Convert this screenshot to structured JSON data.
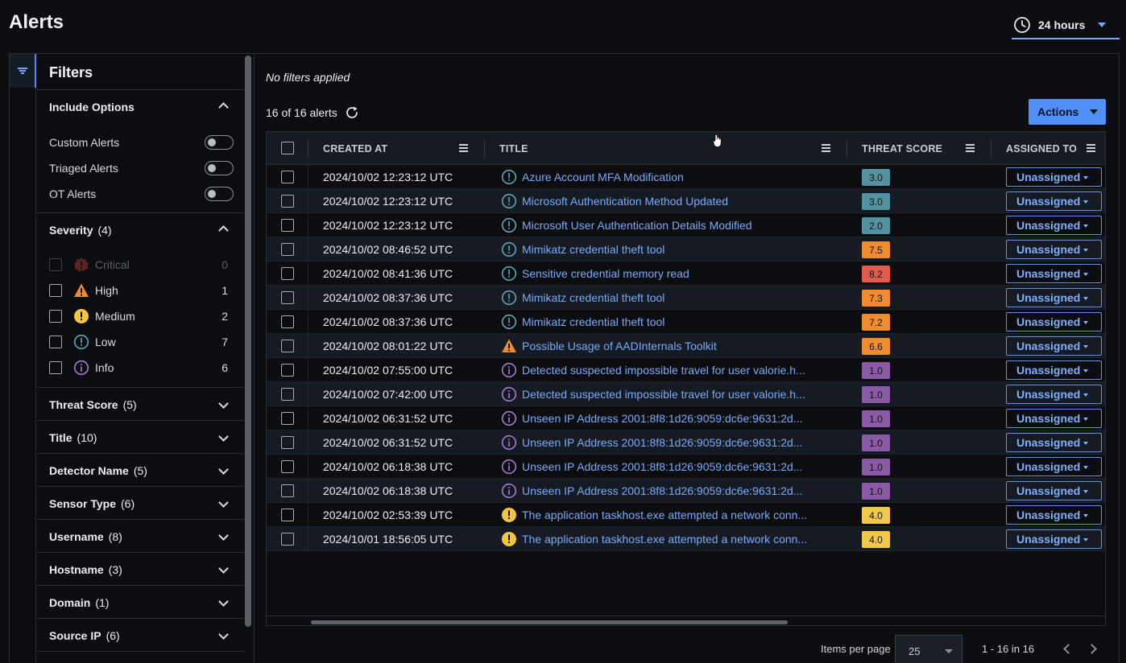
{
  "page": {
    "title": "Alerts"
  },
  "time_range": {
    "label": "24 hours",
    "icon": "clock-icon"
  },
  "filters": {
    "title": "Filters",
    "include_options": {
      "label": "Include Options",
      "options": [
        {
          "label": "Custom Alerts",
          "enabled": false
        },
        {
          "label": "Triaged Alerts",
          "enabled": false
        },
        {
          "label": "OT Alerts",
          "enabled": false
        }
      ]
    },
    "severity": {
      "label": "Severity",
      "count": "(4)",
      "levels": [
        {
          "name": "Critical",
          "count": "0",
          "icon": "critical-icon",
          "color": "#e0453a"
        },
        {
          "name": "High",
          "count": "1",
          "icon": "high-warning-icon",
          "color": "#f08c2e"
        },
        {
          "name": "Medium",
          "count": "2",
          "icon": "medium-exclamation-icon",
          "color": "#f5c542"
        },
        {
          "name": "Low",
          "count": "7",
          "icon": "low-info-icon",
          "color": "#5ea6b5"
        },
        {
          "name": "Info",
          "count": "6",
          "icon": "info-icon",
          "color": "#a57bd0"
        }
      ]
    },
    "groups": [
      {
        "label": "Threat Score",
        "count": "(5)"
      },
      {
        "label": "Title",
        "count": "(10)"
      },
      {
        "label": "Detector Name",
        "count": "(5)"
      },
      {
        "label": "Sensor Type",
        "count": "(6)"
      },
      {
        "label": "Username",
        "count": "(8)"
      },
      {
        "label": "Hostname",
        "count": "(3)"
      },
      {
        "label": "Domain",
        "count": "(1)"
      },
      {
        "label": "Source IP",
        "count": "(6)"
      }
    ]
  },
  "main": {
    "filter_status": "No filters applied",
    "alert_count": "16 of 16 alerts",
    "actions_label": "Actions"
  },
  "table": {
    "columns": [
      "CREATED AT",
      "TITLE",
      "THREAT SCORE",
      "ASSIGNED TO"
    ],
    "rows": [
      {
        "created": "2024/10/02 12:23:12 UTC",
        "severity": "low",
        "title": "Azure Account MFA Modification",
        "score": "3.0",
        "assigned": "Unassigned"
      },
      {
        "created": "2024/10/02 12:23:12 UTC",
        "severity": "low",
        "title": "Microsoft Authentication Method Updated",
        "score": "3.0",
        "assigned": "Unassigned"
      },
      {
        "created": "2024/10/02 12:23:12 UTC",
        "severity": "low",
        "title": "Microsoft User Authentication Details Modified",
        "score": "2.0",
        "assigned": "Unassigned"
      },
      {
        "created": "2024/10/02 08:46:52 UTC",
        "severity": "low",
        "title": "Mimikatz credential theft tool",
        "score": "7.5",
        "assigned": "Unassigned"
      },
      {
        "created": "2024/10/02 08:41:36 UTC",
        "severity": "low",
        "title": "Sensitive credential memory read",
        "score": "8.2",
        "assigned": "Unassigned"
      },
      {
        "created": "2024/10/02 08:37:36 UTC",
        "severity": "low",
        "title": "Mimikatz credential theft tool",
        "score": "7.3",
        "assigned": "Unassigned"
      },
      {
        "created": "2024/10/02 08:37:36 UTC",
        "severity": "low",
        "title": "Mimikatz credential theft tool",
        "score": "7.2",
        "assigned": "Unassigned"
      },
      {
        "created": "2024/10/02 08:01:22 UTC",
        "severity": "high",
        "title": "Possible Usage of AADInternals Toolkit",
        "score": "6.6",
        "assigned": "Unassigned"
      },
      {
        "created": "2024/10/02 07:55:00 UTC",
        "severity": "info",
        "title": "Detected suspected impossible travel for user valorie.h...",
        "score": "1.0",
        "assigned": "Unassigned"
      },
      {
        "created": "2024/10/02 07:42:00 UTC",
        "severity": "info",
        "title": "Detected suspected impossible travel for user valorie.h...",
        "score": "1.0",
        "assigned": "Unassigned"
      },
      {
        "created": "2024/10/02 06:31:52 UTC",
        "severity": "info",
        "title": "Unseen IP Address 2001:8f8:1d26:9059:dc6e:9631:2d...",
        "score": "1.0",
        "assigned": "Unassigned"
      },
      {
        "created": "2024/10/02 06:31:52 UTC",
        "severity": "info",
        "title": "Unseen IP Address 2001:8f8:1d26:9059:dc6e:9631:2d...",
        "score": "1.0",
        "assigned": "Unassigned"
      },
      {
        "created": "2024/10/02 06:18:38 UTC",
        "severity": "info",
        "title": "Unseen IP Address 2001:8f8:1d26:9059:dc6e:9631:2d...",
        "score": "1.0",
        "assigned": "Unassigned"
      },
      {
        "created": "2024/10/02 06:18:38 UTC",
        "severity": "info",
        "title": "Unseen IP Address 2001:8f8:1d26:9059:dc6e:9631:2d...",
        "score": "1.0",
        "assigned": "Unassigned"
      },
      {
        "created": "2024/10/02 02:53:39 UTC",
        "severity": "medium",
        "title": "The application taskhost.exe attempted a network conn...",
        "score": "4.0",
        "assigned": "Unassigned"
      },
      {
        "created": "2024/10/01 18:56:05 UTC",
        "severity": "medium",
        "title": "The application taskhost.exe attempted a network conn...",
        "score": "4.0",
        "assigned": "Unassigned"
      }
    ]
  },
  "pagination": {
    "items_per_page_label": "Items per page",
    "items_per_page_value": "25",
    "range": "1 - 16 in 16"
  },
  "colors": {
    "accent": "#4f8ff7",
    "link": "#79aaf7",
    "score_teal": "#52939f",
    "score_orange": "#f08c2e",
    "score_red": "#e55b4b",
    "score_yellow": "#f2c84b",
    "score_purple": "#8a5aa6"
  }
}
